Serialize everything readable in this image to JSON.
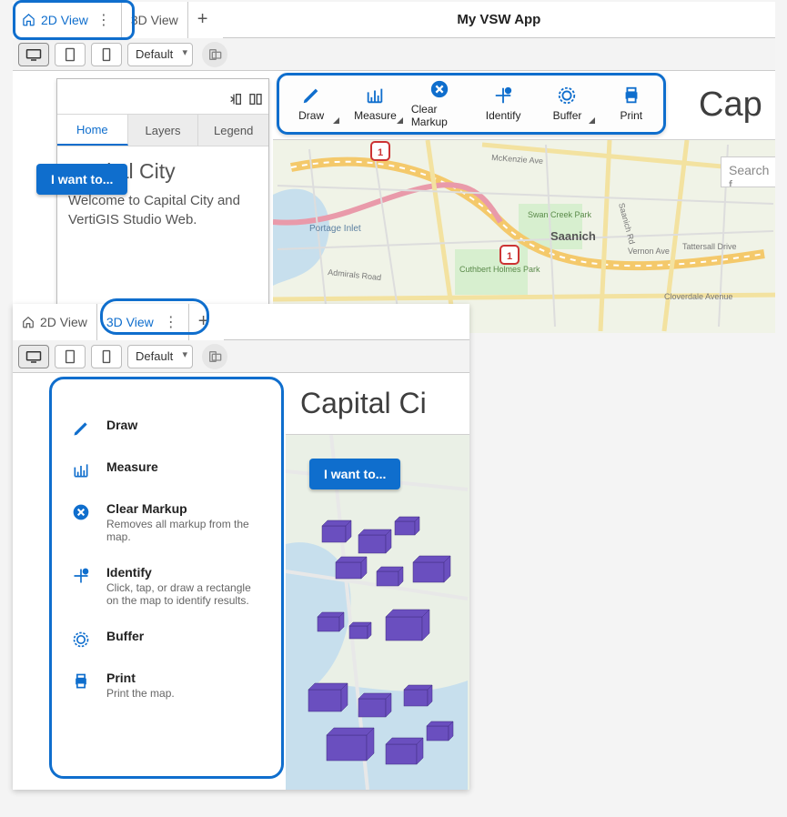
{
  "appTitle": "My VSW App",
  "tabs": {
    "v2d": "2D View",
    "v3d": "3D View"
  },
  "device": {
    "layout": "Default"
  },
  "sidepanel": {
    "tabs": {
      "home": "Home",
      "layers": "Layers",
      "legend": "Legend"
    },
    "title": "Capital City",
    "welcome": "Welcome to Capital City and VertiGIS Studio Web."
  },
  "toolbar": {
    "draw": "Draw",
    "measure": "Measure",
    "clear": "Clear Markup",
    "identify": "Identify",
    "buffer": "Buffer",
    "print": "Print"
  },
  "bigTitleTop": "Cap",
  "bigTitleBot": "Capital Ci",
  "iwant": "I want to...",
  "searchPlaceholder": "Search f",
  "mapLabels": {
    "portage": "Portage Inlet",
    "mckenzie": "McKenzie Ave",
    "admirals": "Admirals Road",
    "swancreek": "Swan Creek Park",
    "cuthbert": "Cuthbert Holmes Park",
    "saanich": "Saanich",
    "saanichrd": "Saanich Rd",
    "vernon": "Vernon Ave",
    "tattersall": "Tattersall Drive",
    "cloverdale": "Cloverdale Avenue",
    "hwy1": "1"
  },
  "menu": {
    "draw": {
      "t": "Draw"
    },
    "measure": {
      "t": "Measure"
    },
    "clear": {
      "t": "Clear Markup",
      "d": "Removes all markup from the map."
    },
    "identify": {
      "t": "Identify",
      "d": "Click, tap, or draw a rectangle on the map to identify results."
    },
    "buffer": {
      "t": "Buffer"
    },
    "print": {
      "t": "Print",
      "d": "Print the map."
    }
  }
}
